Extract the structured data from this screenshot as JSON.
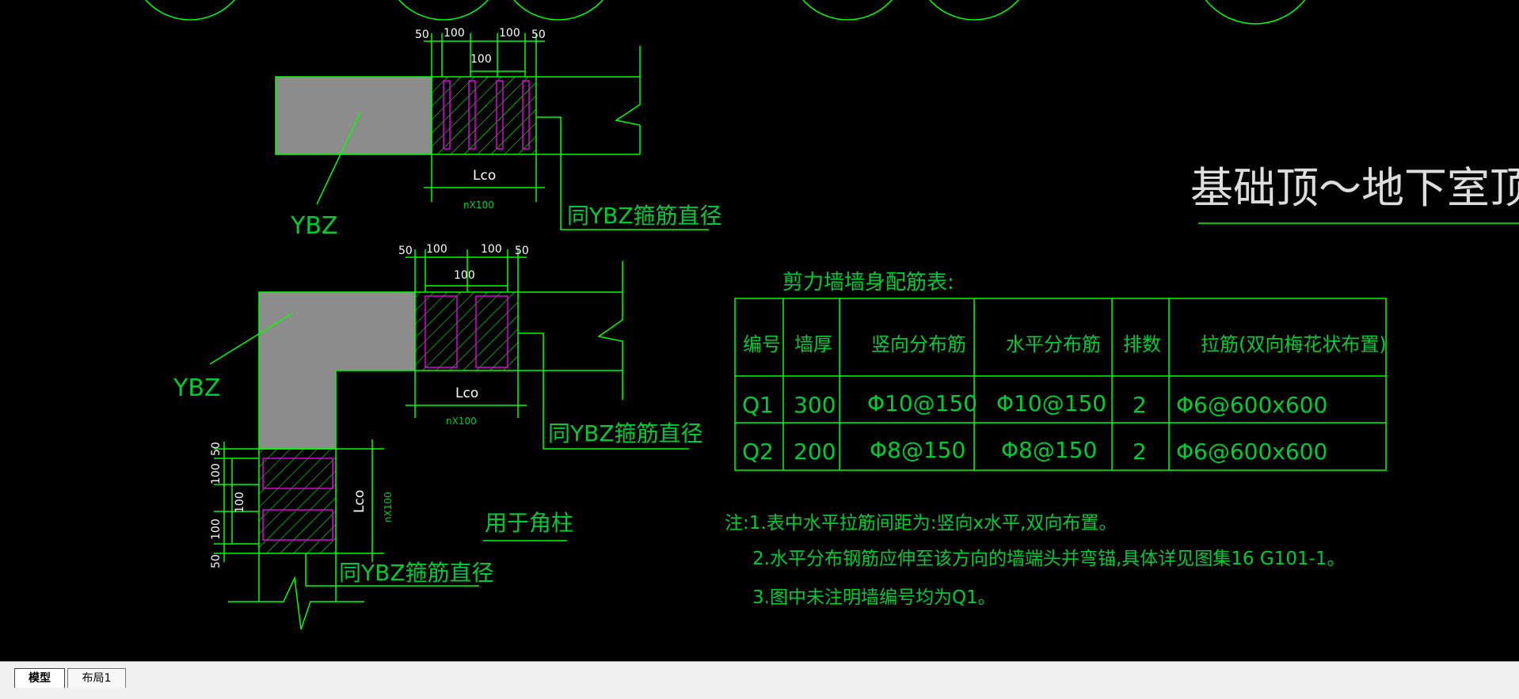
{
  "drawing": {
    "title": "基础顶～地下室顶板",
    "detail1": {
      "dims": [
        "50",
        "100",
        "100",
        "100",
        "50"
      ],
      "center_dim": "100",
      "label_ybz": "YBZ",
      "lco": "Lco",
      "nx": "nX100",
      "note": "同YBZ箍筋直径"
    },
    "detail2": {
      "dims": [
        "50",
        "100",
        "100",
        "50"
      ],
      "center_dim": "100",
      "label_ybz": "YBZ",
      "lco": "Lco",
      "nx": "nX100",
      "note": "同YBZ箍筋直径",
      "vdims": [
        "50",
        "100",
        "100",
        "100",
        "50"
      ],
      "vlco": "Lco",
      "vnx": "nX100",
      "note2": "同YBZ箍筋直径",
      "corner_label": "用于角柱"
    },
    "table": {
      "caption": "剪力墙墙身配筋表:",
      "headers": [
        "编号",
        "墙厚",
        "竖向分布筋",
        "水平分布筋",
        "排数",
        "拉筋(双向梅花状布置)"
      ],
      "rows": [
        [
          "Q1",
          "300",
          "Φ10@150",
          "Φ10@150",
          "2",
          "Φ6@600x600"
        ],
        [
          "Q2",
          "200",
          "Φ8@150",
          "Φ8@150",
          "2",
          "Φ6@600x600"
        ]
      ]
    },
    "notes": [
      "注:1.表中水平拉筋间距为:竖向x水平,双向布置。",
      "2.水平分布钢筋应伸至该方向的墙端头并弯锚,具体详见图集16 G101-1。",
      "3.图中未注明墙编号均为Q1。"
    ]
  },
  "tabs": [
    {
      "label": "模型",
      "active": true
    },
    {
      "label": "布局1",
      "active": false
    }
  ],
  "colors": {
    "line": "#00ff00",
    "text": "#00cc33",
    "fill": "#8c8c8c",
    "rebar": "#ff00ff",
    "white": "#ffffff"
  }
}
